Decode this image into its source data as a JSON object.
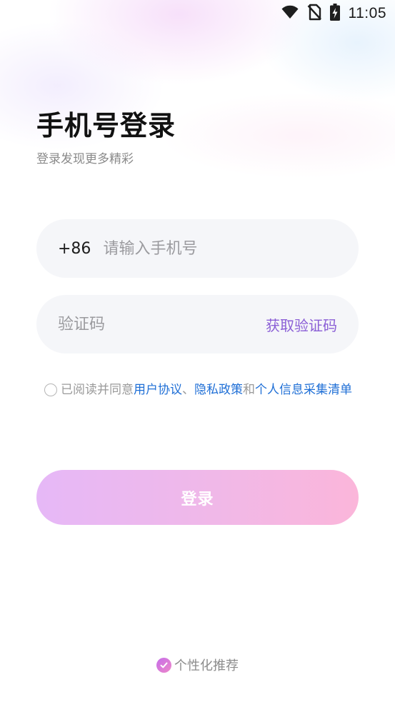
{
  "status_bar": {
    "time": "11:05",
    "icons": [
      "wifi-icon",
      "no-sim-icon",
      "battery-charging-icon"
    ]
  },
  "header": {
    "title": "手机号登录",
    "subtitle": "登录发现更多精彩"
  },
  "phone_field": {
    "country_code": "+86",
    "placeholder": "请输入手机号",
    "value": ""
  },
  "code_field": {
    "placeholder": "验证码",
    "value": "",
    "get_code_label": "获取验证码"
  },
  "agreement": {
    "checked": false,
    "prefix": "已阅读并同意",
    "link_user_agreement": "用户协议",
    "sep1": "、",
    "link_privacy_policy": "隐私政策",
    "sep2": "和",
    "link_info_collection": "个人信息采集清单"
  },
  "login_button": {
    "label": "登录"
  },
  "personalize": {
    "checked": true,
    "label": "个性化推荐"
  },
  "colors": {
    "accent_purple": "#8b5fd6",
    "link_blue": "#1f6fd6",
    "button_gradient_start": "#e6b8f7",
    "button_gradient_end": "#fbb6da",
    "field_background": "#f5f6f9"
  }
}
